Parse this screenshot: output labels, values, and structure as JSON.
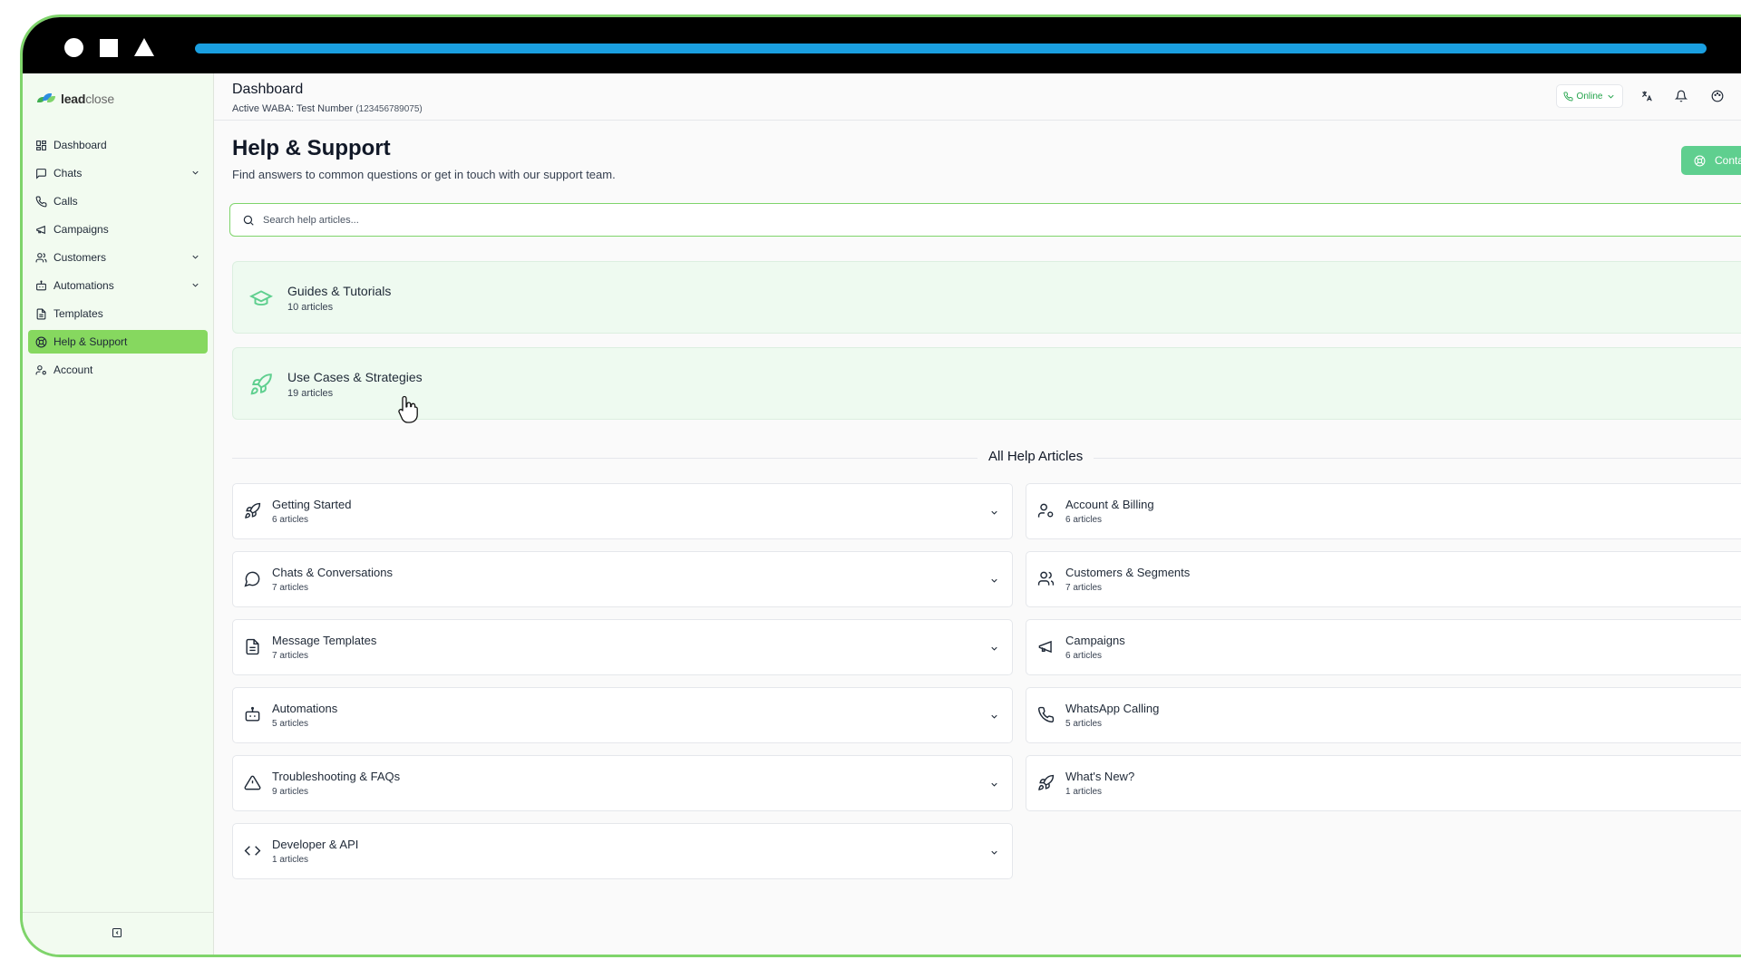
{
  "app": {
    "logo_bold": "lead",
    "logo_rest": "close"
  },
  "colors": {
    "accent": "#86d85f",
    "frame": "#7fd46b",
    "progress": "#1a9fe0",
    "online": "#22a34a",
    "contact": "#5fcf8f"
  },
  "sidebar": {
    "items": [
      {
        "label": "Dashboard",
        "icon": "dashboard-icon"
      },
      {
        "label": "Chats",
        "icon": "chat-bubble-icon",
        "expandable": true
      },
      {
        "label": "Calls",
        "icon": "phone-icon"
      },
      {
        "label": "Campaigns",
        "icon": "megaphone-icon"
      },
      {
        "label": "Customers",
        "icon": "users-icon",
        "expandable": true
      },
      {
        "label": "Automations",
        "icon": "bot-icon",
        "expandable": true
      },
      {
        "label": "Templates",
        "icon": "file-text-icon"
      },
      {
        "label": "Help & Support",
        "icon": "help-circle-icon",
        "active": true
      },
      {
        "label": "Account",
        "icon": "user-cog-icon"
      }
    ]
  },
  "header": {
    "title": "Dashboard",
    "waba_prefix": "Active WABA:",
    "waba_name": "Test Number",
    "waba_number": "(123456789075)",
    "status": "Online"
  },
  "page": {
    "title": "Help & Support",
    "subtitle": "Find answers to common questions or get in touch with our support team.",
    "contact_button": "Conta",
    "search_placeholder": "Search help articles..."
  },
  "featured": [
    {
      "title": "Guides & Tutorials",
      "count": "10 articles",
      "icon": "graduation-cap-icon"
    },
    {
      "title": "Use Cases & Strategies",
      "count": "19 articles",
      "icon": "rocket-icon"
    }
  ],
  "section_title": "All Help Articles",
  "categories_left": [
    {
      "title": "Getting Started",
      "count": "6 articles",
      "icon": "rocket-icon"
    },
    {
      "title": "Chats & Conversations",
      "count": "7 articles",
      "icon": "chat-bubble-icon"
    },
    {
      "title": "Message Templates",
      "count": "7 articles",
      "icon": "file-text-icon"
    },
    {
      "title": "Automations",
      "count": "5 articles",
      "icon": "bot-icon"
    },
    {
      "title": "Troubleshooting & FAQs",
      "count": "9 articles",
      "icon": "warning-triangle-icon"
    },
    {
      "title": "Developer & API",
      "count": "1 articles",
      "icon": "code-icon"
    }
  ],
  "categories_right": [
    {
      "title": "Account & Billing",
      "count": "6 articles",
      "icon": "user-cog-icon"
    },
    {
      "title": "Customers & Segments",
      "count": "7 articles",
      "icon": "users-icon"
    },
    {
      "title": "Campaigns",
      "count": "6 articles",
      "icon": "megaphone-icon"
    },
    {
      "title": "WhatsApp Calling",
      "count": "5 articles",
      "icon": "phone-icon"
    },
    {
      "title": "What's New?",
      "count": "1 articles",
      "icon": "rocket-icon"
    }
  ]
}
